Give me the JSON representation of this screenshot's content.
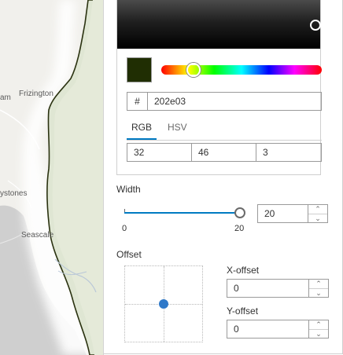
{
  "map": {
    "places": [
      "Frizington",
      "am",
      "ystones",
      "Seascale"
    ]
  },
  "color_picker": {
    "selected_color": "#202e03",
    "hex_prefix": "#",
    "hex_value": "202e03",
    "hue_position": 0.2,
    "tabs": [
      {
        "label": "RGB",
        "active": true
      },
      {
        "label": "HSV",
        "active": false
      }
    ],
    "channels": [
      "32",
      "46",
      "3"
    ]
  },
  "width": {
    "label": "Width",
    "slider_min": "0",
    "slider_max": "20",
    "value": "20"
  },
  "offset": {
    "label": "Offset",
    "x_label": "X-offset",
    "x_value": "0",
    "y_label": "Y-offset",
    "y_value": "0"
  },
  "colors": {
    "accent": "#007ac2",
    "offset_dot": "#2f79c9"
  }
}
